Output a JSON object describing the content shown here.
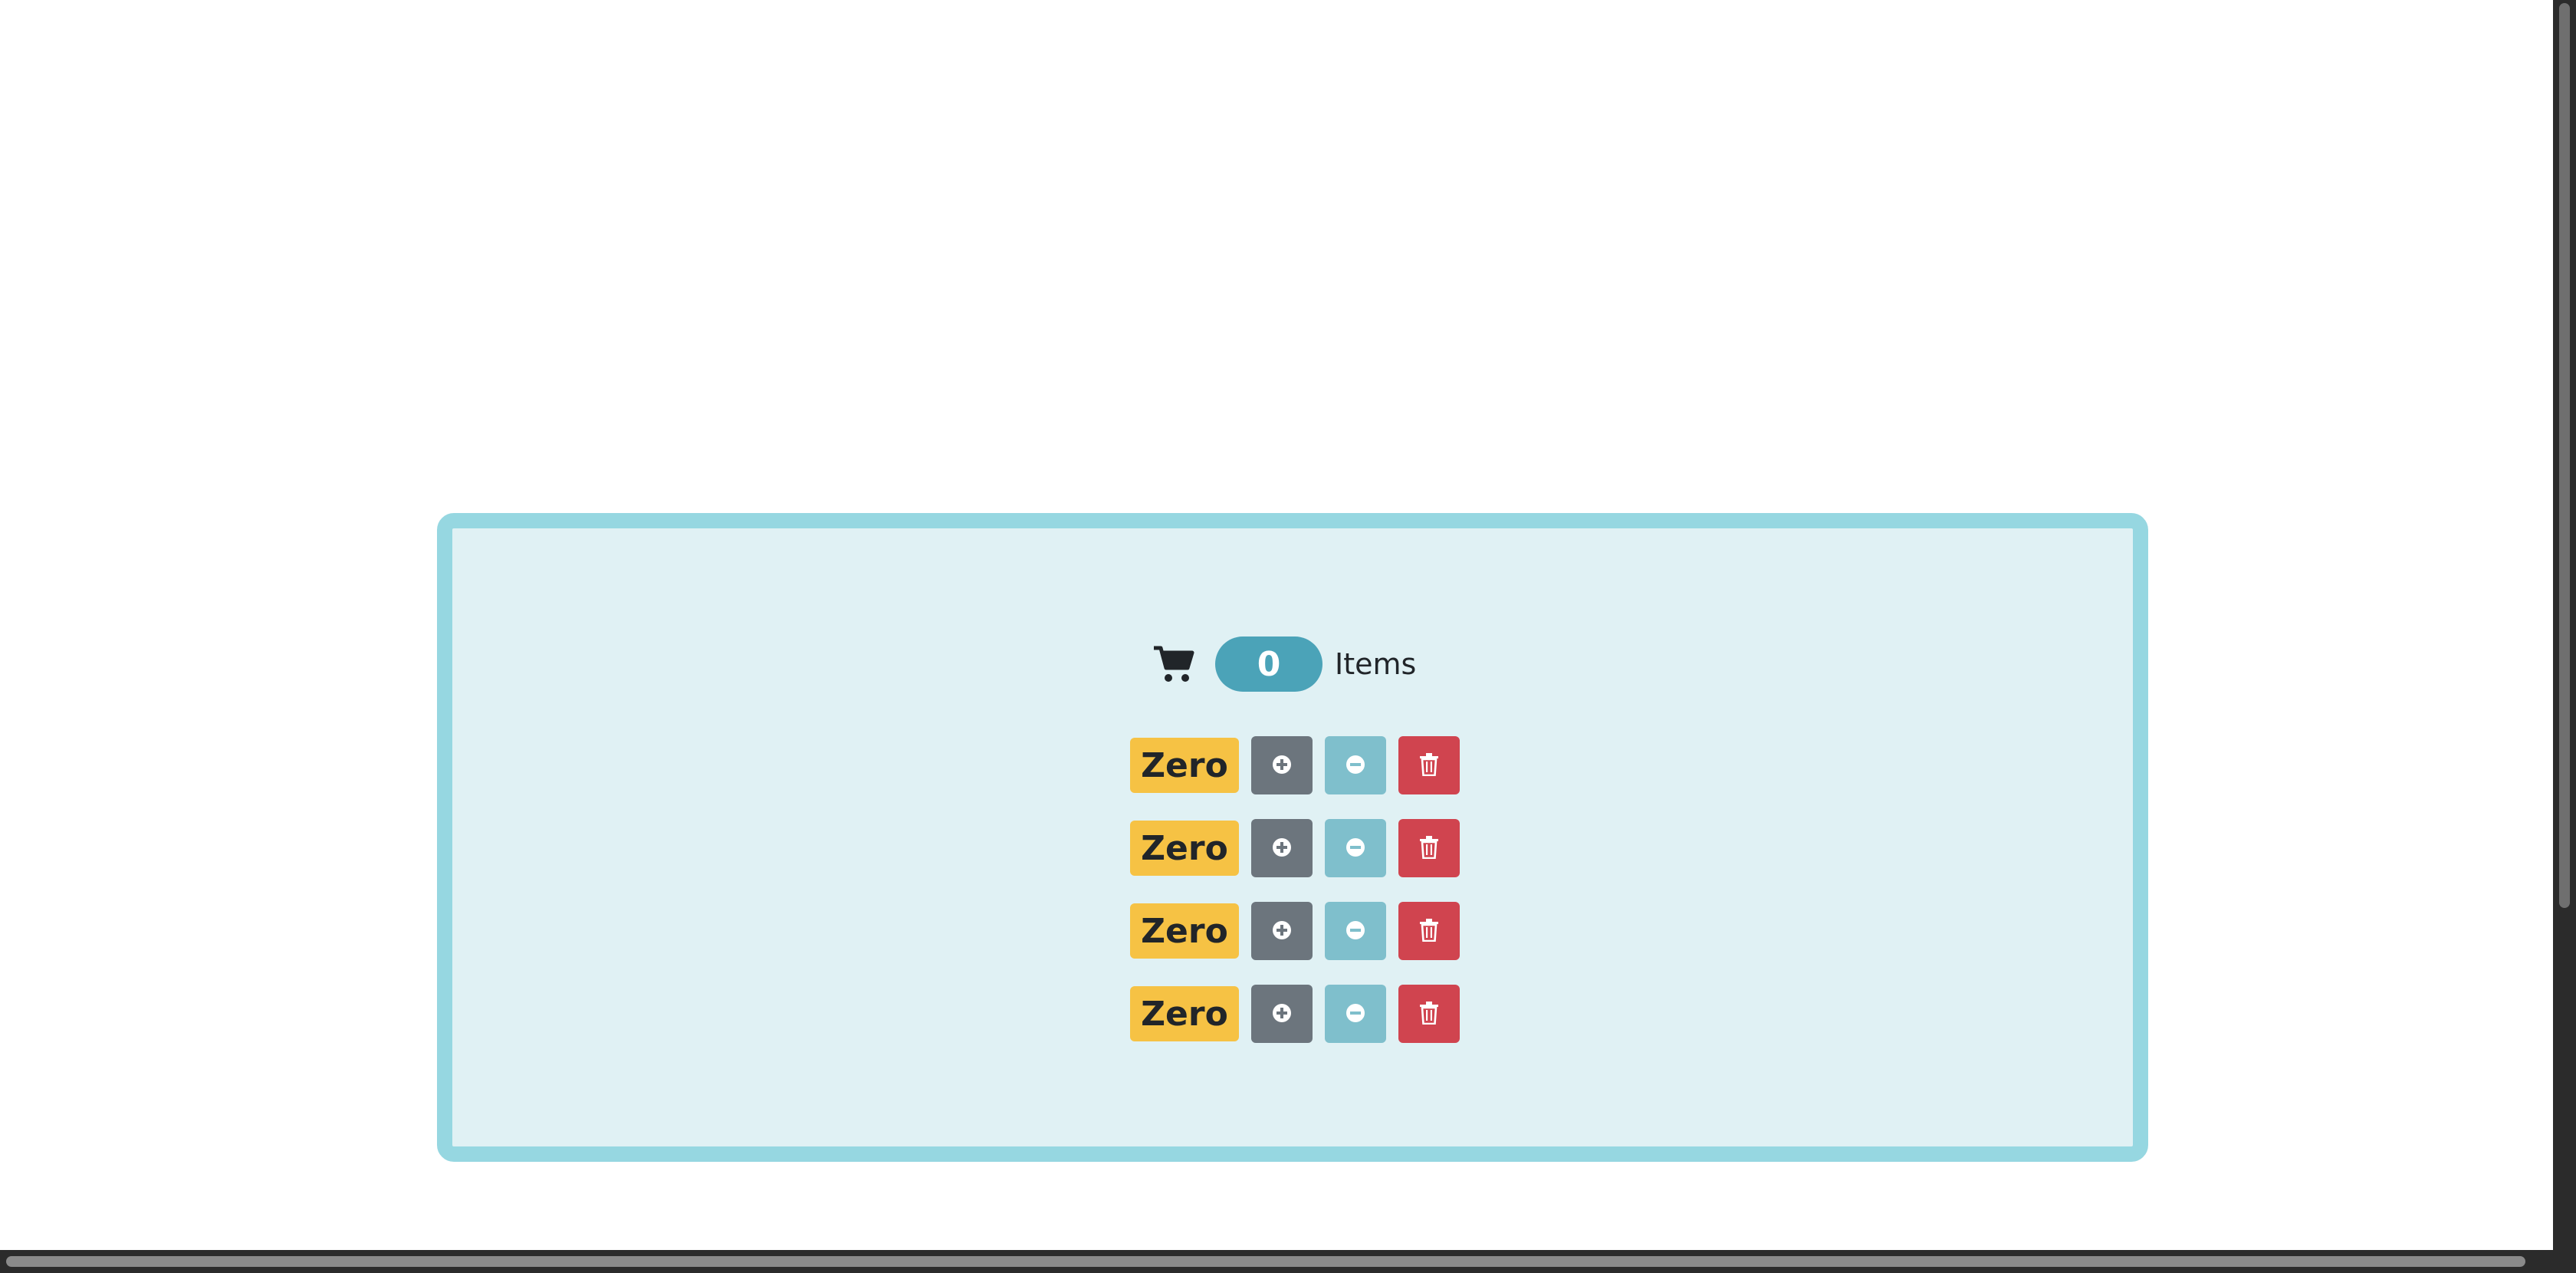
{
  "cart": {
    "icon": "cart-icon",
    "count": "0",
    "label": "Items",
    "badge_color": "#4ba3b8"
  },
  "counters": [
    {
      "value": "Zero"
    },
    {
      "value": "Zero"
    },
    {
      "value": "Zero"
    },
    {
      "value": "Zero"
    }
  ],
  "buttons": {
    "increment_icon": "plus-circle-icon",
    "decrement_icon": "minus-circle-icon",
    "delete_icon": "trash-icon"
  },
  "colors": {
    "panel_bg": "#e0f1f4",
    "panel_border": "#96d7e1",
    "value_badge": "#f6c244",
    "increment": "#6c757d",
    "decrement": "#7fbfcc",
    "delete": "#d0444f"
  }
}
